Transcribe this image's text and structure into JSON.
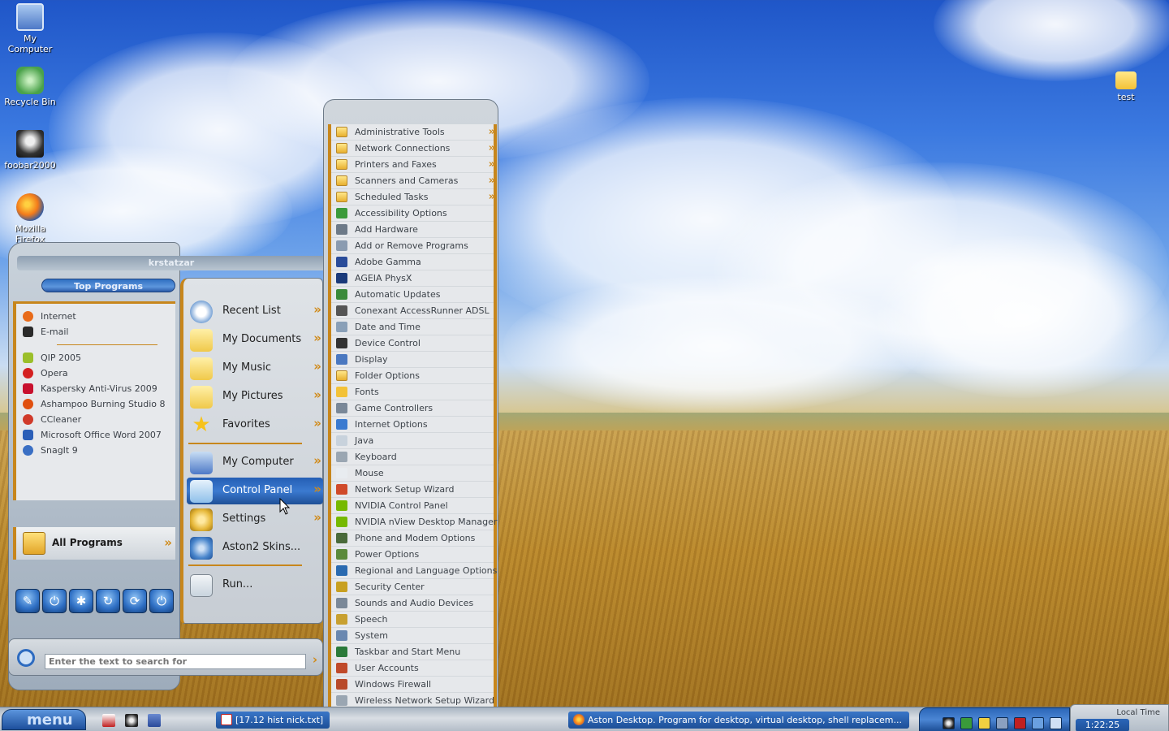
{
  "desktop": {
    "icons": [
      {
        "label": "My Computer",
        "icon": "my-computer-icon"
      },
      {
        "label": "Recycle Bin",
        "icon": "recycle-bin-icon"
      },
      {
        "label": "foobar2000",
        "icon": "foobar2000-icon"
      },
      {
        "label": "Mozilla Firefox",
        "icon": "firefox-icon"
      },
      {
        "label": "test",
        "icon": "folder-icon"
      }
    ]
  },
  "start_menu": {
    "user_name": "krstatzar",
    "top_programs_label": "Top Programs",
    "pinned": [
      {
        "label": "Internet",
        "icon": "firefox-icon",
        "color": "#e86b1a"
      },
      {
        "label": "E-mail",
        "icon": "email-icon",
        "color": "#2a2a2a"
      }
    ],
    "recent": [
      {
        "label": "QIP 2005",
        "icon": "qip-icon",
        "color": "#9bbf2a"
      },
      {
        "label": "Opera",
        "icon": "opera-icon",
        "color": "#d42020"
      },
      {
        "label": "Kaspersky Anti-Virus 2009",
        "icon": "kaspersky-icon",
        "color": "#c8102e"
      },
      {
        "label": "Ashampoo Burning Studio 8",
        "icon": "ashampoo-icon",
        "color": "#e05010"
      },
      {
        "label": "CCleaner",
        "icon": "ccleaner-icon",
        "color": "#d03a2a"
      },
      {
        "label": "Microsoft Office Word 2007",
        "icon": "word-icon",
        "color": "#2b5fb8"
      },
      {
        "label": "SnagIt 9",
        "icon": "snagit-icon",
        "color": "#3a6fc4"
      }
    ],
    "all_programs_label": "All Programs",
    "power_buttons": [
      "tools-icon",
      "power-icon",
      "snowflake-icon",
      "restart-icon",
      "refresh-icon",
      "shutdown-icon"
    ],
    "middle": [
      {
        "label": "Recent List",
        "icon": "clock-icon",
        "color": "#7aa4d6",
        "arrow": true
      },
      {
        "label": "My Documents",
        "icon": "folder-documents-icon",
        "color": "#f0c94a",
        "arrow": true
      },
      {
        "label": "My Music",
        "icon": "folder-music-icon",
        "color": "#f0c94a",
        "arrow": true
      },
      {
        "label": "My Pictures",
        "icon": "folder-pictures-icon",
        "color": "#f0c94a",
        "arrow": true
      },
      {
        "label": "Favorites",
        "icon": "star-icon",
        "color": "#f7d23a",
        "arrow": true
      },
      {
        "label": "My Computer",
        "icon": "computer-icon",
        "color": "#7aa4d6",
        "arrow": true
      },
      {
        "label": "Control Panel",
        "icon": "control-panel-icon",
        "color": "#8fc0ea",
        "arrow": true,
        "active": true
      },
      {
        "label": "Settings",
        "icon": "settings-icon",
        "color": "#e6b83a",
        "arrow": true
      },
      {
        "label": "Aston2 Skins...",
        "icon": "skins-icon",
        "color": "#4a86cc",
        "arrow": false
      },
      {
        "label": "Run...",
        "icon": "run-icon",
        "color": "#c9d4de",
        "arrow": false
      }
    ],
    "search_placeholder": "Enter the text to search for"
  },
  "control_panel": [
    {
      "label": "Administrative Tools",
      "icon": "folder-icon",
      "color": "#f3c237",
      "arrow": true
    },
    {
      "label": "Network Connections",
      "icon": "folder-icon",
      "color": "#f3c237",
      "arrow": true
    },
    {
      "label": "Printers and Faxes",
      "icon": "folder-icon",
      "color": "#f3c237",
      "arrow": true
    },
    {
      "label": "Scanners and Cameras",
      "icon": "folder-icon",
      "color": "#f3c237",
      "arrow": true
    },
    {
      "label": "Scheduled Tasks",
      "icon": "folder-icon",
      "color": "#f3c237",
      "arrow": true
    },
    {
      "label": "Accessibility Options",
      "icon": "accessibility-icon",
      "color": "#3a9a3a"
    },
    {
      "label": "Add Hardware",
      "icon": "hardware-icon",
      "color": "#6d7a88"
    },
    {
      "label": "Add or Remove Programs",
      "icon": "programs-icon",
      "color": "#8a9bb0"
    },
    {
      "label": "Adobe Gamma",
      "icon": "monitor-icon",
      "color": "#2a4c9a"
    },
    {
      "label": "AGEIA PhysX",
      "icon": "physx-icon",
      "color": "#1a3a7a"
    },
    {
      "label": "Automatic Updates",
      "icon": "updates-icon",
      "color": "#3a8a3a"
    },
    {
      "label": "Conexant AccessRunner ADSL",
      "icon": "modem-icon",
      "color": "#555555"
    },
    {
      "label": "Date and Time",
      "icon": "clock-icon",
      "color": "#8aa0b8"
    },
    {
      "label": "Device Control",
      "icon": "device-icon",
      "color": "#333333"
    },
    {
      "label": "Display",
      "icon": "display-icon",
      "color": "#4a78c0"
    },
    {
      "label": "Folder Options",
      "icon": "folder-icon",
      "color": "#f3c237"
    },
    {
      "label": "Fonts",
      "icon": "fonts-icon",
      "color": "#f3c237"
    },
    {
      "label": "Game Controllers",
      "icon": "gamepad-icon",
      "color": "#7a8898"
    },
    {
      "label": "Internet Options",
      "icon": "globe-icon",
      "color": "#3a7ad0"
    },
    {
      "label": "Java",
      "icon": "java-icon",
      "color": "#c8d2dc"
    },
    {
      "label": "Keyboard",
      "icon": "keyboard-icon",
      "color": "#9aa6b2"
    },
    {
      "label": "Mouse",
      "icon": "mouse-icon",
      "color": "#e8ecf0"
    },
    {
      "label": "Network Setup Wizard",
      "icon": "network-icon",
      "color": "#d04a2a"
    },
    {
      "label": "NVIDIA Control Panel",
      "icon": "nvidia-icon",
      "color": "#76b900"
    },
    {
      "label": "NVIDIA nView Desktop Manager",
      "icon": "nvidia-icon",
      "color": "#76b900"
    },
    {
      "label": "Phone and Modem Options",
      "icon": "phone-icon",
      "color": "#4a6a3a"
    },
    {
      "label": "Power Options",
      "icon": "power-icon",
      "color": "#5a8a3a"
    },
    {
      "label": "Regional and Language Options",
      "icon": "globe-icon",
      "color": "#2a6ab0"
    },
    {
      "label": "Security Center",
      "icon": "shield-icon",
      "color": "#c8a020"
    },
    {
      "label": "Sounds and Audio Devices",
      "icon": "speaker-icon",
      "color": "#7a8898"
    },
    {
      "label": "Speech",
      "icon": "speech-icon",
      "color": "#c8a030"
    },
    {
      "label": "System",
      "icon": "system-icon",
      "color": "#6a88b0"
    },
    {
      "label": "Taskbar and Start Menu",
      "icon": "taskbar-icon",
      "color": "#2a7a3a"
    },
    {
      "label": "User Accounts",
      "icon": "users-icon",
      "color": "#c04a2a"
    },
    {
      "label": "Windows Firewall",
      "icon": "firewall-icon",
      "color": "#b84a2a"
    },
    {
      "label": "Wireless Network Setup Wizard",
      "icon": "wireless-icon",
      "color": "#9aa6b2"
    }
  ],
  "taskbar": {
    "start_label": "menu",
    "tasks": [
      {
        "label": "[17.12 hist nick.txt]",
        "icon": "notepad-icon"
      },
      {
        "label": "Aston Desktop. Program for desktop, virtual desktop, shell replacem...",
        "icon": "firefox-icon"
      }
    ],
    "clock_label": "Local Time",
    "clock_time": "1:22:25"
  }
}
